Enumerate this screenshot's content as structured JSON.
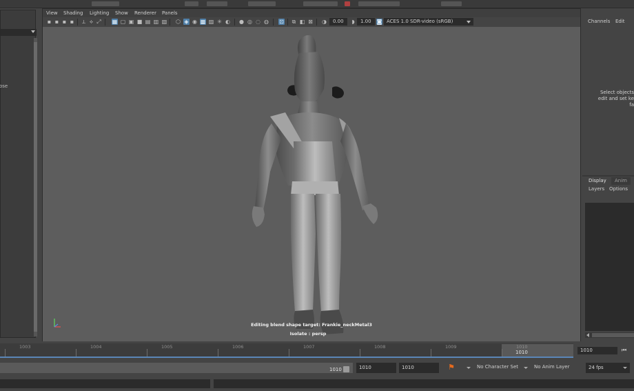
{
  "viewport_menu": [
    "View",
    "Shading",
    "Lighting",
    "Show",
    "Renderer",
    "Panels"
  ],
  "toolbar": {
    "exposure": "0.00",
    "gamma": "1.00",
    "color_space": "ACES 1.0 SDR-video (sRGB)"
  },
  "left_panel": {
    "text": "ose"
  },
  "viewport": {
    "hud_line1": "Editing blend shape target: Frankie_neckMetal3",
    "hud_line2": "Isolate : persp"
  },
  "channel_box": {
    "tabs": [
      "Channels",
      "Edit"
    ],
    "message_lines": [
      "Select objects",
      "edit and set ke",
      "fa"
    ]
  },
  "layer_editor": {
    "tabs": [
      "Display",
      "Anim"
    ],
    "menus": [
      "Layers",
      "Options"
    ]
  },
  "time_slider": {
    "tick_labels": [
      "1003",
      "1004",
      "1005",
      "1006",
      "1007",
      "1008",
      "1009",
      "1010"
    ],
    "current_frame_label": "1010",
    "current_frame_field": "1010"
  },
  "range_slider": {
    "end_label": "1010",
    "start_field": "1010",
    "end_field": "1010",
    "character_set": "No Character Set",
    "anim_layer": "No Anim Layer",
    "fps": "24 fps"
  },
  "colors": {
    "accent_blue": "#4f7fa8",
    "timeline_blue": "#5a86b8",
    "key_icon_orange": "#e46a1e",
    "viewport_bg": "#5d5d5d"
  }
}
